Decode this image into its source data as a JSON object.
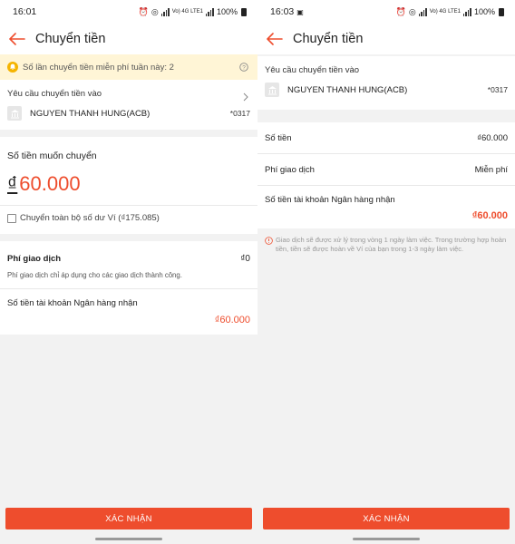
{
  "left": {
    "status": {
      "time": "16:01",
      "battery": "100%",
      "network": "Vo) 4G LTE1"
    },
    "appbar": {
      "title": "Chuyển tiền"
    },
    "notice": {
      "text": "Số lần chuyển tiền miễn phí tuần này: 2"
    },
    "recipient": {
      "label": "Yêu cầu chuyển tiền vào",
      "name": "NGUYEN THANH HUNG(ACB)",
      "account": "*0317"
    },
    "amount": {
      "title": "Số tiền muốn chuyển",
      "currency": "₫",
      "value": "60.000"
    },
    "transfer_all": {
      "label": "Chuyển toàn bộ số dư Ví (₫175.085)"
    },
    "fee": {
      "title": "Phí giao dịch",
      "value": "₫0",
      "note": "Phí giao dịch chỉ áp dụng cho các giao dịch thành công."
    },
    "received": {
      "label": "Số tiền tài khoản Ngân hàng nhận",
      "value": "₫60.000"
    },
    "confirm_label": "XÁC NHẬN"
  },
  "right": {
    "status": {
      "time": "16:03",
      "battery": "100%",
      "network": "Vo) 4G LTE1"
    },
    "appbar": {
      "title": "Chuyển tiền"
    },
    "recipient": {
      "label": "Yêu cầu chuyển tiền vào",
      "name": "NGUYEN THANH HUNG(ACB)",
      "account": "*0317"
    },
    "rows": {
      "amount_label": "Số tiền",
      "amount_value": "₫60.000",
      "fee_label": "Phí giao dịch",
      "fee_value": "Miễn phí"
    },
    "received": {
      "label": "Số tiền tài khoản Ngân hàng nhận",
      "value": "₫60.000"
    },
    "info_note": "Giao dịch sẽ được xử lý trong vòng 1 ngày làm việc. Trong trường hợp hoàn tiền, tiền sẽ được hoàn về Ví của bạn trong 1-3 ngày làm việc.",
    "confirm_label": "XÁC NHẬN"
  },
  "colors": {
    "accent": "#ee4d2d",
    "notice_bg": "#fff5d6"
  }
}
